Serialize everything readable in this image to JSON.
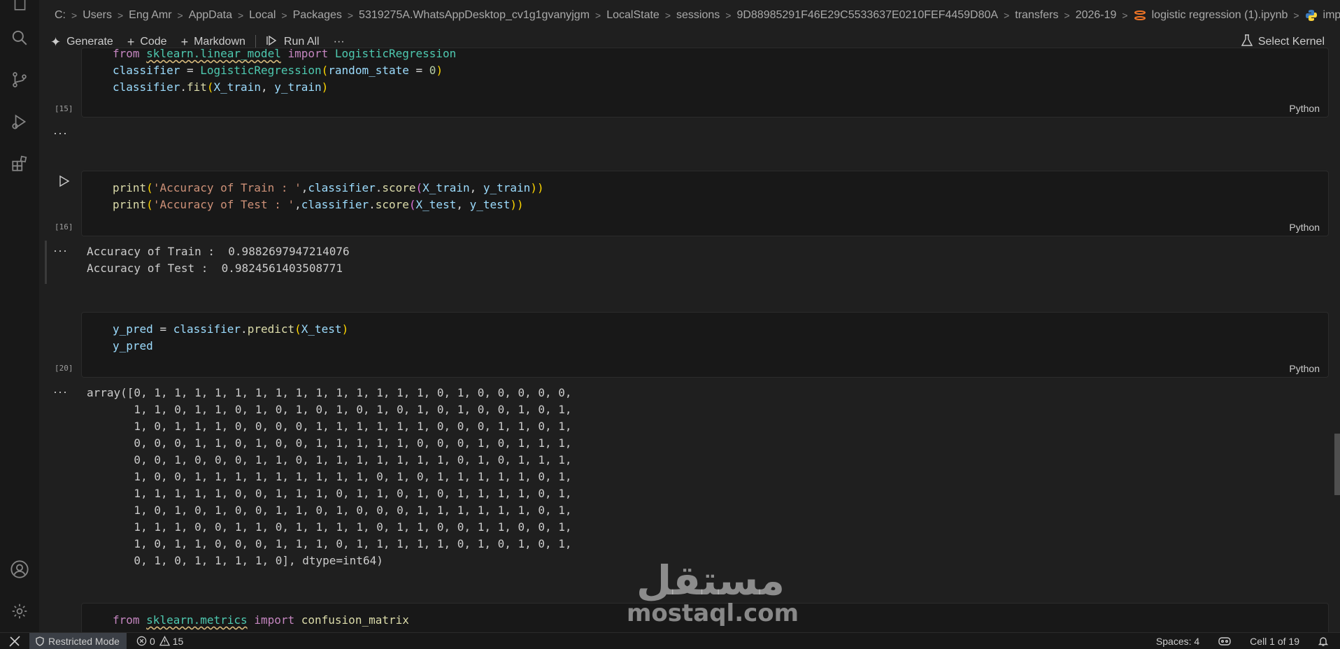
{
  "breadcrumb": {
    "items": [
      "C:",
      "Users",
      "Eng Amr",
      "AppData",
      "Local",
      "Packages",
      "5319275A.WhatsAppDesktop_cv1g1gvanyjgm",
      "LocalState",
      "sessions",
      "9D88985291F46E29C5533637E0210FEF4459D80A",
      "transfers",
      "2026-19",
      "logistic regression (1).ipynb",
      "import numpy"
    ]
  },
  "toolbar": {
    "generate": "Generate",
    "code": "Code",
    "markdown": "Markdown",
    "run_all": "Run All",
    "more": "···",
    "select_kernel": "Select Kernel"
  },
  "cells": {
    "c15": {
      "line1": [
        "from",
        "sklearn.linear_model",
        "import",
        "LogisticRegression"
      ],
      "line2": [
        "classifier",
        "=",
        "LogisticRegression",
        "(",
        "random_state",
        "=",
        "0",
        ")"
      ],
      "line3": [
        "classifier",
        ".",
        "fit",
        "(",
        "X_train",
        ",",
        "y_train",
        ")"
      ],
      "exec": "[15]",
      "lang": "Python",
      "ellipsis": "···"
    },
    "c16": {
      "line1": [
        "print",
        "(",
        "'Accuracy of Train : '",
        ",",
        "classifier",
        ".",
        "score",
        "(",
        "X_train",
        ",",
        "y_train",
        "))"
      ],
      "line2": [
        "print",
        "(",
        "'Accuracy of Test : '",
        ",",
        "classifier",
        ".",
        "score",
        "(",
        "X_test",
        ",",
        "y_test",
        "))"
      ],
      "exec": "[16]",
      "lang": "Python",
      "ellipsis": "···",
      "output": "Accuracy of Train :  0.9882697947214076\nAccuracy of Test :  0.9824561403508771"
    },
    "c20": {
      "line1": [
        "y_pred",
        "=",
        "classifier",
        ".",
        "predict",
        "(",
        "X_test",
        ")"
      ],
      "line2": [
        "y_pred"
      ],
      "exec": "[20]",
      "lang": "Python",
      "ellipsis": "···",
      "output": "array([0, 1, 1, 1, 1, 1, 1, 1, 1, 1, 1, 1, 1, 1, 1, 0, 1, 0, 0, 0, 0, 0,\n       1, 1, 0, 1, 1, 0, 1, 0, 1, 0, 1, 0, 1, 0, 1, 0, 1, 0, 0, 1, 0, 1,\n       1, 0, 1, 1, 1, 0, 0, 0, 0, 1, 1, 1, 1, 1, 1, 0, 0, 0, 1, 1, 0, 1,\n       0, 0, 0, 1, 1, 0, 1, 0, 0, 1, 1, 1, 1, 1, 0, 0, 0, 1, 0, 1, 1, 1,\n       0, 0, 1, 0, 0, 0, 1, 1, 0, 1, 1, 1, 1, 1, 1, 1, 0, 1, 0, 1, 1, 1,\n       1, 0, 0, 1, 1, 1, 1, 1, 1, 1, 1, 1, 0, 1, 0, 1, 1, 1, 1, 1, 0, 1,\n       1, 1, 1, 1, 1, 0, 0, 1, 1, 1, 0, 1, 1, 0, 1, 0, 1, 1, 1, 1, 0, 1,\n       1, 0, 1, 0, 1, 0, 0, 1, 1, 0, 1, 0, 0, 0, 1, 1, 1, 1, 1, 1, 0, 1,\n       1, 1, 1, 0, 0, 1, 1, 0, 1, 1, 1, 1, 0, 1, 1, 0, 0, 1, 1, 0, 0, 1,\n       1, 0, 1, 1, 0, 0, 0, 1, 1, 1, 0, 1, 1, 1, 1, 1, 0, 1, 0, 1, 0, 1,\n       0, 1, 0, 1, 1, 1, 1, 0], dtype=int64)"
    },
    "c21": {
      "line1": [
        "from",
        "sklearn.metrics",
        "import",
        "confusion_matrix"
      ]
    }
  },
  "watermark": {
    "arabic": "مستقل",
    "latin": "mostaql.com"
  },
  "status": {
    "restricted": "Restricted Mode",
    "errors": "0",
    "warnings": "15",
    "spaces": "Spaces: 4",
    "cell": "Cell 1 of 19"
  },
  "icons": {
    "activity": [
      "files-icon",
      "search-icon",
      "source-control-icon",
      "run-debug-icon",
      "extensions-icon",
      "account-icon",
      "settings-icon"
    ],
    "status": [
      "remote-icon",
      "shield-icon",
      "error-icon",
      "warning-icon",
      "copilot-icon",
      "bell-icon"
    ]
  }
}
